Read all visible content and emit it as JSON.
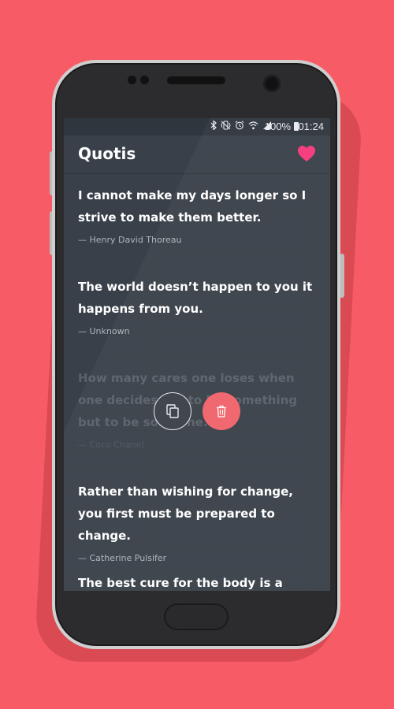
{
  "status_bar": {
    "icons": [
      "bluetooth-icon",
      "vibrate-icon",
      "alarm-icon",
      "wifi-icon",
      "signal-icon"
    ],
    "battery": "100%",
    "time": "01:24"
  },
  "app": {
    "title": "Quotis",
    "favorite_icon": "heart-icon",
    "accent_color": "#f5397a",
    "background_color": "#394049"
  },
  "quotes": [
    {
      "text": "I cannot make my days longer so I strive to make them better.",
      "author": "— Henry David Thoreau",
      "selected": false
    },
    {
      "text": "The world doesn’t happen to you it happens from you.",
      "author": "— Unknown",
      "selected": false
    },
    {
      "text": "How many cares one loses when one decides not to be something but to be someone.",
      "author": "— Coco Chanel",
      "selected": true
    },
    {
      "text": "Rather than wishing for change, you first must be prepared to change.",
      "author": "— Catherine Pulsifer",
      "selected": false
    },
    {
      "text": "The best cure for the body is a quiet",
      "author": "",
      "selected": false
    }
  ],
  "quote_actions": {
    "copy_icon": "copy-icon",
    "delete_icon": "trash-icon",
    "delete_color": "#f0636b"
  },
  "page_background": "#f75c66"
}
